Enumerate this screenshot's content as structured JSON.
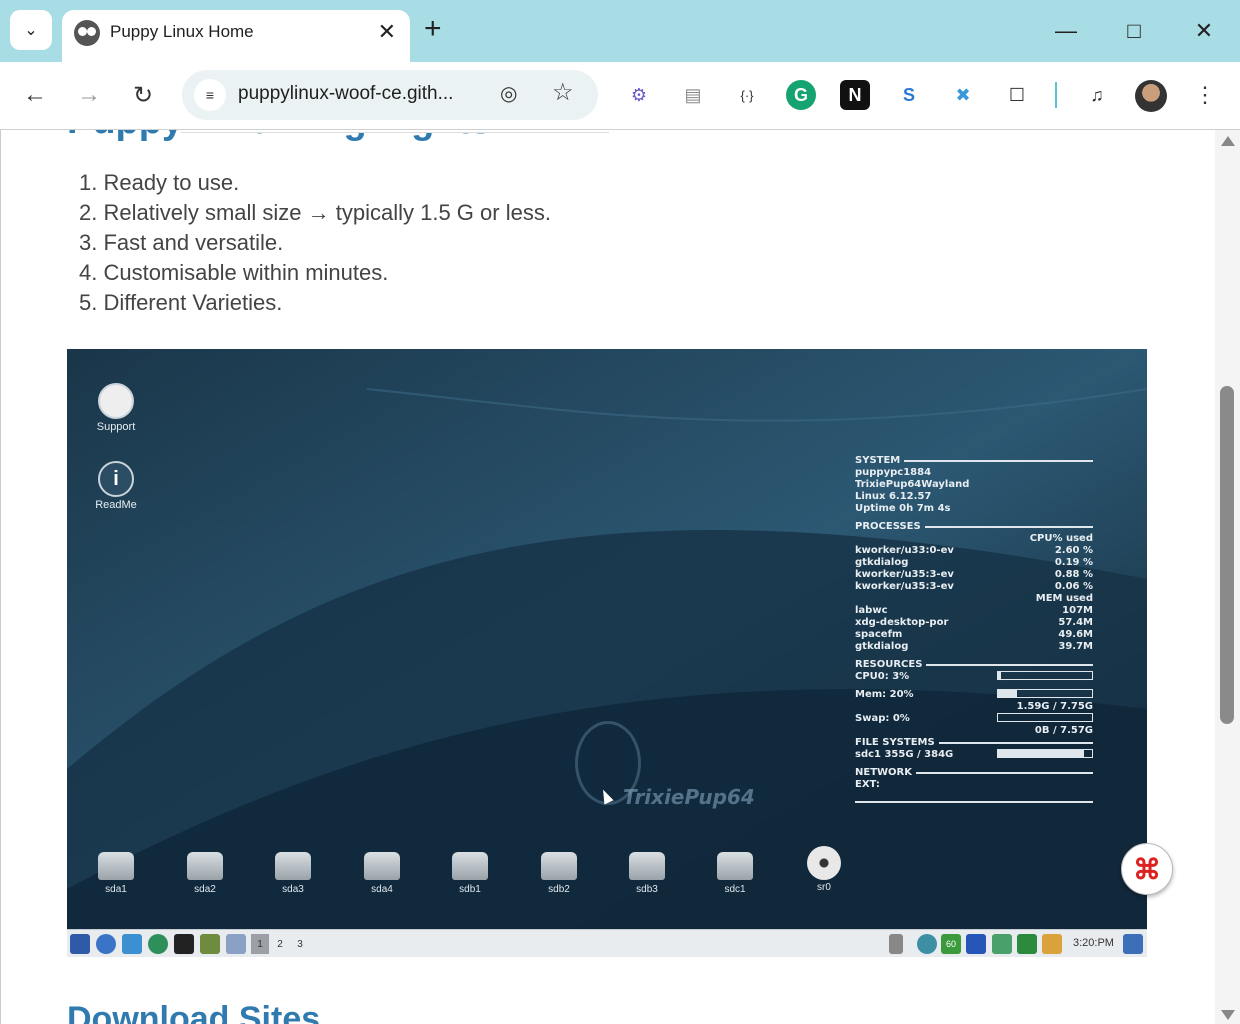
{
  "browser": {
    "tab_title": "Puppy Linux Home",
    "url": "puppylinux-woof-ce.gith...",
    "icons": [
      "tab-search-icon",
      "puppy-favicon-icon",
      "close-icon",
      "plus-icon",
      "minimize-icon",
      "maximize-icon",
      "close-window-icon",
      "back-icon",
      "forward-icon",
      "reload-icon",
      "site-settings-icon",
      "eye-slash-icon",
      "star-icon",
      "gear-extension-icon",
      "screenshot-extension-icon",
      "json-extension-icon",
      "grammarly-icon",
      "notion-icon",
      "sync-icon",
      "network-extension-icon",
      "extensions-puzzle-icon",
      "media-control-icon",
      "profile-avatar",
      "more-vert-icon"
    ]
  },
  "page": {
    "heading_partial": "Puppy Linux Highlights",
    "features": [
      "1. Ready to use.",
      "2. Relatively small size → typically 1.5 G or less.",
      "3. Fast and versatile.",
      "4. Customisable within minutes.",
      "5. Different Varieties."
    ],
    "download_heading": "Download Sites"
  },
  "screenshot": {
    "desktop_icons": [
      {
        "label": "Support"
      },
      {
        "label": "ReadMe"
      }
    ],
    "drives": [
      "sda1",
      "sda2",
      "sda3",
      "sda4",
      "sdb1",
      "sdb2",
      "sdb3",
      "sdc1",
      "sr0"
    ],
    "watermark": "TrixiePup64",
    "conky": {
      "system_header": "SYSTEM",
      "host": "puppypc1884",
      "distro": "TrixiePup64Wayland",
      "kernel": "Linux 6.12.57",
      "uptime": "Uptime 0h 7m 4s",
      "processes_header": "PROCESSES",
      "cpu_col": "CPU% used",
      "cpu_procs": [
        {
          "name": "kworker/u33:0-ev",
          "val": "2.60 %"
        },
        {
          "name": "gtkdialog",
          "val": "0.19 %"
        },
        {
          "name": "kworker/u35:3-ev",
          "val": "0.88 %"
        },
        {
          "name": "kworker/u35:3-ev",
          "val": "0.06 %"
        }
      ],
      "mem_col": "MEM  used",
      "mem_procs": [
        {
          "name": "labwc",
          "val": "107M"
        },
        {
          "name": "xdg-desktop-por",
          "val": "57.4M"
        },
        {
          "name": "spacefm",
          "val": "49.6M"
        },
        {
          "name": "gtkdialog",
          "val": "39.7M"
        }
      ],
      "resources_header": "RESOURCES",
      "cpu0": "CPU0: 3%",
      "cpu0_level": 0.03,
      "mem": "Mem: 20%",
      "mem_level": 0.2,
      "mem_detail": "1.59G / 7.75G",
      "swap": "Swap: 0%",
      "swap_level": 0,
      "swap_detail": "0B / 7.57G",
      "fs_header": "FILE SYSTEMS",
      "fs_line": "sdc1 355G / 384G",
      "fs_level": 0.92,
      "network_header": "NETWORK",
      "ext": "EXT:"
    },
    "workspaces": [
      "1",
      "2",
      "3"
    ],
    "clock": "3:20:PM",
    "tray_badge": "60"
  },
  "colors": {
    "link_blue": "#2f7bb0",
    "titlebar": "#a9dde5",
    "desktop_bg": "#1f3e52"
  }
}
